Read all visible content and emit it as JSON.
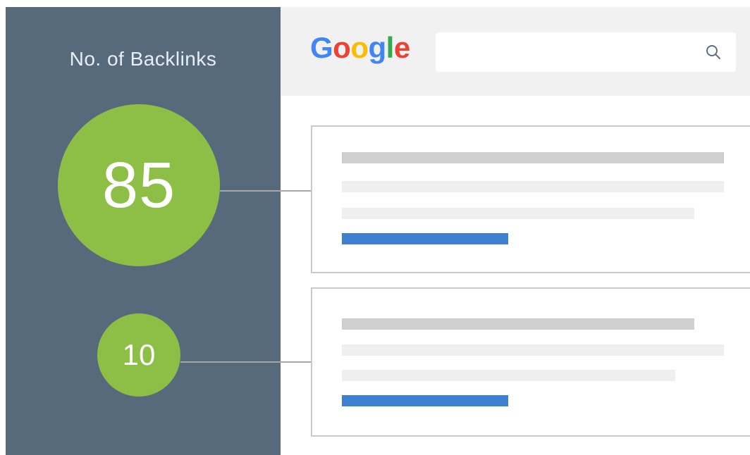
{
  "sidebar": {
    "title": "No. of Backlinks",
    "background": "#576a7c"
  },
  "backlinks": [
    {
      "value": "85",
      "color": "#8dbe45"
    },
    {
      "value": "10",
      "color": "#8dbe45"
    }
  ],
  "search": {
    "logo": "Google",
    "logo_letters": [
      {
        "letter": "G",
        "color": "#4285f4"
      },
      {
        "letter": "o",
        "color": "#ea4335"
      },
      {
        "letter": "o",
        "color": "#fbbc05"
      },
      {
        "letter": "g",
        "color": "#4285f4"
      },
      {
        "letter": "l",
        "color": "#34a853"
      },
      {
        "letter": "e",
        "color": "#ea4335"
      }
    ],
    "icon": "search-icon"
  },
  "colors": {
    "title_line": "#cfcfcf",
    "text_line": "#efefef",
    "link_line": "#3d7fd0",
    "connector": "#a7a7a7"
  }
}
